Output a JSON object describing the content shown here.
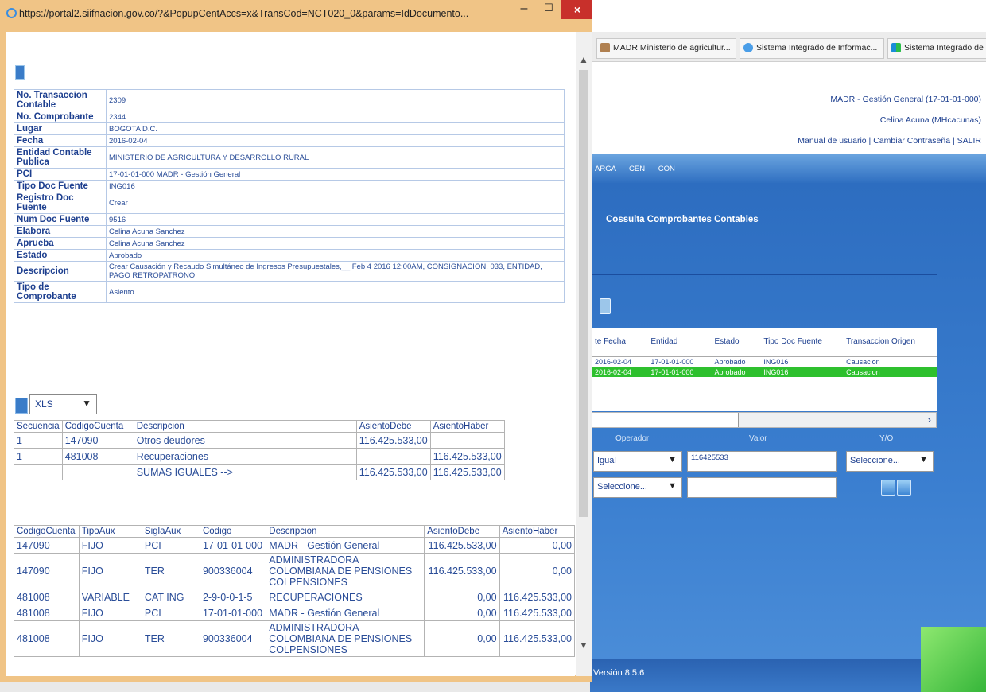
{
  "background": {
    "tabs": [
      {
        "label": "MADR Ministerio de agricultur...",
        "icon": "page-icon"
      },
      {
        "label": "Sistema Integrado de Informac...",
        "icon": "ie-icon"
      },
      {
        "label": "Sistema Integrado de",
        "icon": "windows-icon"
      }
    ],
    "header": {
      "entity": "MADR - Gestión General (17-01-01-000)",
      "user": "Celina Acuna (MHcacunas)",
      "links": "Manual de usuario | Cambiar Contraseña | SALIR"
    },
    "nav": "ARGA CEN CON",
    "section_title": "Cossulta Comprobantes Contables",
    "results": {
      "columns": [
        "te Fecha",
        "Entidad",
        "Estado",
        "Tipo Doc Fuente",
        "Transaccion Origen"
      ],
      "rows": [
        [
          "2016-02-04",
          "17-01-01-000",
          "Aprobado",
          "ING016",
          "Causacion"
        ],
        [
          "2016-02-04",
          "17-01-01-000",
          "Aprobado",
          "ING016",
          "Causacion"
        ]
      ]
    },
    "filters": {
      "operador_label": "Operador",
      "valor_label": "Valor",
      "yo_label": "Y/O",
      "operador_value": "Igual",
      "valor_value": "116425533",
      "yo_value": "Seleccione...",
      "operador2_value": "Seleccione..."
    },
    "version": "Versión 8.5.6"
  },
  "popup": {
    "title": "https://portal2.siifnacion.gov.co/?&PopupCentAccs=x&TransCod=NCT020_0&params=IdDocumento...",
    "info": [
      {
        "label": "No. Transaccion Contable",
        "value": "2309"
      },
      {
        "label": "No. Comprobante",
        "value": "2344"
      },
      {
        "label": "Lugar",
        "value": "BOGOTA D.C."
      },
      {
        "label": "Fecha",
        "value": "2016-02-04"
      },
      {
        "label": "Entidad Contable Publica",
        "value": "MINISTERIO DE AGRICULTURA Y DESARROLLO RURAL"
      },
      {
        "label": "PCI",
        "value": "17-01-01-000 MADR - Gestión General"
      },
      {
        "label": "Tipo Doc Fuente",
        "value": "ING016"
      },
      {
        "label": "Registro Doc Fuente",
        "value": "Crear"
      },
      {
        "label": "Num Doc Fuente",
        "value": "9516"
      },
      {
        "label": "Elabora",
        "value": "Celina Acuna Sanchez"
      },
      {
        "label": "Aprueba",
        "value": "Celina Acuna Sanchez"
      },
      {
        "label": "Estado",
        "value": "Aprobado"
      },
      {
        "label": "Descripcion",
        "value": "Crear Causación y Recaudo Simultáneo de Ingresos Presupuestales,__ Feb 4 2016 12:00AM, CONSIGNACION, 033, ENTIDAD, PAGO RETROPATRONO"
      },
      {
        "label": "Tipo de Comprobante",
        "value": "Asiento"
      }
    ],
    "export_format": "XLS",
    "asiento": {
      "columns": [
        "Secuencia",
        "CodigoCuenta",
        "Descripcion",
        "AsientoDebe",
        "AsientoHaber"
      ],
      "rows": [
        [
          "1",
          "147090",
          "Otros deudores",
          "116.425.533,00",
          ""
        ],
        [
          "1",
          "481008",
          "Recuperaciones",
          "",
          "116.425.533,00"
        ],
        [
          "",
          "",
          "SUMAS IGUALES -->",
          "116.425.533,00",
          "116.425.533,00"
        ]
      ]
    },
    "detalle": {
      "columns": [
        "CodigoCuenta",
        "TipoAux",
        "SiglaAux",
        "Codigo",
        "Descripcion",
        "AsientoDebe",
        "AsientoHaber"
      ],
      "rows": [
        [
          "147090",
          "FIJO",
          "PCI",
          "17-01-01-000",
          "MADR - Gestión General",
          "116.425.533,00",
          "0,00"
        ],
        [
          "147090",
          "FIJO",
          "TER",
          "900336004",
          "ADMINISTRADORA COLOMBIANA DE PENSIONES COLPENSIONES",
          "116.425.533,00",
          "0,00"
        ],
        [
          "481008",
          "VARIABLE",
          "CAT ING",
          "2-9-0-0-1-5",
          "RECUPERACIONES",
          "0,00",
          "116.425.533,00"
        ],
        [
          "481008",
          "FIJO",
          "PCI",
          "17-01-01-000",
          "MADR - Gestión General",
          "0,00",
          "116.425.533,00"
        ],
        [
          "481008",
          "FIJO",
          "TER",
          "900336004",
          "ADMINISTRADORA COLOMBIANA DE PENSIONES COLPENSIONES",
          "0,00",
          "116.425.533,00"
        ]
      ]
    }
  }
}
